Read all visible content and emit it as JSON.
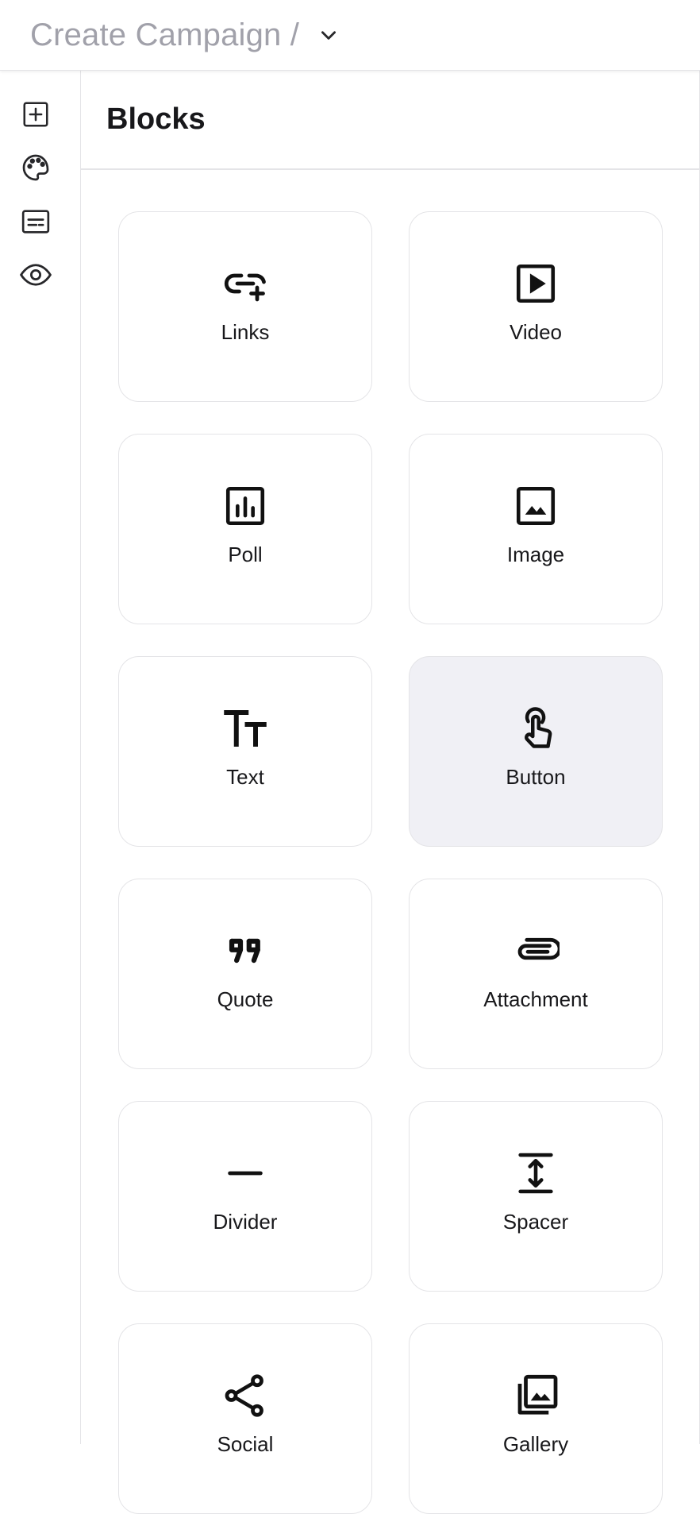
{
  "header": {
    "title": "Create Campaign /",
    "dropdown_icon": "chevron-down-icon"
  },
  "rail": {
    "items": [
      {
        "name": "add-block",
        "icon": "plus-square-icon"
      },
      {
        "name": "theme",
        "icon": "palette-icon"
      },
      {
        "name": "form",
        "icon": "form-icon"
      },
      {
        "name": "preview",
        "icon": "eye-icon"
      }
    ]
  },
  "panel": {
    "title": "Blocks",
    "blocks": [
      {
        "label": "Links",
        "icon": "link-add-icon"
      },
      {
        "label": "Video",
        "icon": "video-play-icon"
      },
      {
        "label": "Poll",
        "icon": "poll-icon"
      },
      {
        "label": "Image",
        "icon": "image-icon"
      },
      {
        "label": "Text",
        "icon": "text-size-icon"
      },
      {
        "label": "Button",
        "icon": "pointer-finger-icon",
        "active": true
      },
      {
        "label": "Quote",
        "icon": "quote-icon"
      },
      {
        "label": "Attachment",
        "icon": "paperclip-icon"
      },
      {
        "label": "Divider",
        "icon": "divider-icon"
      },
      {
        "label": "Spacer",
        "icon": "spacer-icon"
      },
      {
        "label": "Social",
        "icon": "share-icon"
      },
      {
        "label": "Gallery",
        "icon": "gallery-icon"
      }
    ]
  },
  "colors": {
    "active_card": "#f0f0f5",
    "border": "#e4e4e7",
    "muted_text": "#a1a1aa"
  }
}
